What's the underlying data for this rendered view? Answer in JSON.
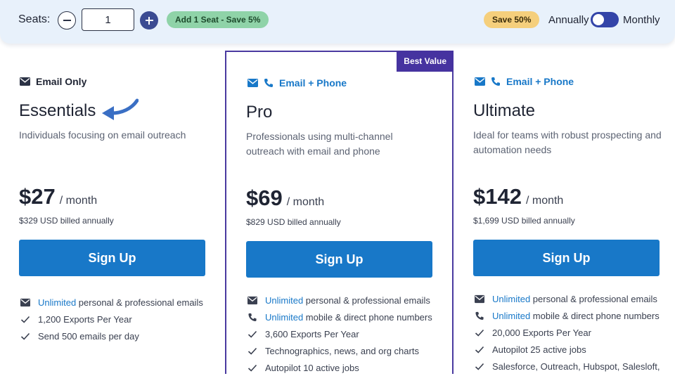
{
  "topbar": {
    "seats_label": "Seats:",
    "seat_count": "1",
    "add_seat_label": "Add 1 Seat - Save 5%",
    "save_label": "Save 50%",
    "annually_label": "Annually",
    "monthly_label": "Monthly"
  },
  "colors": {
    "primary_button": "#1878c8",
    "highlight_text": "#1878c8",
    "best_value_badge": "#4633a0",
    "toggle": "#3344a8",
    "add_seat_pill": "#8fd3a8",
    "save_pill": "#f5cf7c"
  },
  "plans": [
    {
      "channel_label": "Email Only",
      "channel_icons": [
        "envelope-icon"
      ],
      "name": "Essentials",
      "description": "Individuals focusing on email outreach",
      "price": "$27",
      "period": "/ month",
      "billed": "$329 USD billed annually",
      "cta": "Sign Up",
      "features": [
        {
          "icon": "envelope-icon",
          "highlight": "Unlimited",
          "text": " personal & professional emails"
        },
        {
          "icon": "check-icon",
          "highlight": "",
          "text": "1,200 Exports Per Year"
        },
        {
          "icon": "check-icon",
          "highlight": "",
          "text": "Send 500 emails per day"
        }
      ]
    },
    {
      "badge": "Best Value",
      "channel_label": "Email + Phone",
      "channel_icons": [
        "envelope-icon",
        "phone-icon"
      ],
      "name": "Pro",
      "description": "Professionals using multi-channel outreach with email and phone",
      "price": "$69",
      "period": "/ month",
      "billed": "$829 USD billed annually",
      "cta": "Sign Up",
      "features": [
        {
          "icon": "envelope-icon",
          "highlight": "Unlimited",
          "text": " personal & professional emails"
        },
        {
          "icon": "phone-icon",
          "highlight": "Unlimited",
          "text": " mobile & direct phone numbers"
        },
        {
          "icon": "check-icon",
          "highlight": "",
          "text": "3,600 Exports Per Year"
        },
        {
          "icon": "check-icon",
          "highlight": "",
          "text": "Technographics, news, and org charts"
        },
        {
          "icon": "check-icon",
          "highlight": "",
          "text": "Autopilot 10 active jobs"
        }
      ]
    },
    {
      "channel_label": "Email + Phone",
      "channel_icons": [
        "envelope-icon",
        "phone-icon"
      ],
      "name": "Ultimate",
      "description": "Ideal for teams with robust prospecting and automation needs",
      "price": "$142",
      "period": "/ month",
      "billed": "$1,699 USD billed annually",
      "cta": "Sign Up",
      "features": [
        {
          "icon": "envelope-icon",
          "highlight": "Unlimited",
          "text": " personal & professional emails"
        },
        {
          "icon": "phone-icon",
          "highlight": "Unlimited",
          "text": " mobile & direct phone numbers"
        },
        {
          "icon": "check-icon",
          "highlight": "",
          "text": "20,000 Exports Per Year"
        },
        {
          "icon": "check-icon",
          "highlight": "",
          "text": "Autopilot 25 active jobs"
        },
        {
          "icon": "check-icon",
          "highlight": "",
          "text": "Salesforce, Outreach, Hubspot, Salesloft,"
        }
      ]
    }
  ]
}
